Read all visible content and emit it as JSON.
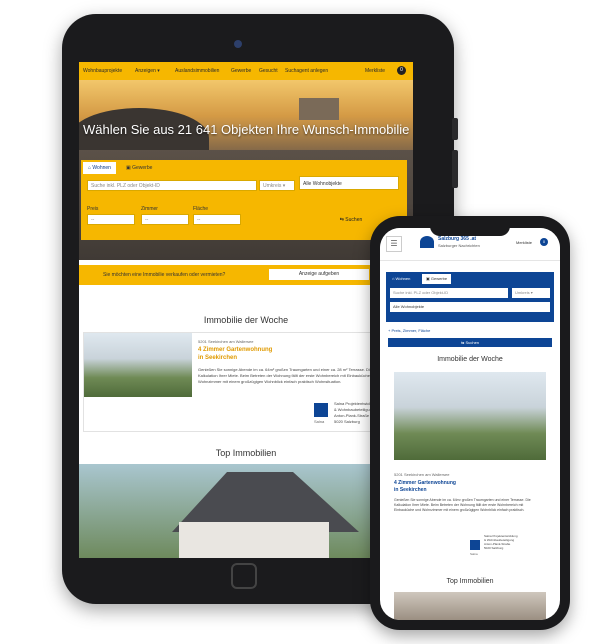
{
  "tablet": {
    "nav": {
      "items": [
        "Wohnbauprojekte",
        "Anzeigen ▾",
        "Auslandsimmobilien",
        "Gewerbe",
        "Gesucht",
        "Suchagent anlegen"
      ],
      "right": "Merkliste",
      "badge": "0"
    },
    "hero": {
      "title": "Wählen Sie aus 21 641 Objekten Ihre Wunsch-Immobilie"
    },
    "search": {
      "tab_wohnen": "⌂ Wohnen",
      "tab_gewerbe": "▣ Gewerbe",
      "input_placeholder": "Suche inkl. PLZ oder Objekt-ID",
      "radius": "Umkreis ▾",
      "type": "Alle Wohnobjekte",
      "label_price": "Preis",
      "label_rooms": "Zimmer",
      "label_area": "Fläche",
      "select_price": "--",
      "select_rooms": "--",
      "select_area": "--",
      "button": "⇆ Suchen"
    },
    "sell_bar": {
      "text": "Sie möchten eine Immobilie verkaufen oder vermieten?",
      "button": "Anzeige aufgeben"
    },
    "week": {
      "title": "Immobilie der Woche",
      "tag": "5201 Seekirchen am Wallersee",
      "prop_title_line1": "4 Zimmer Gartenwohnung",
      "prop_title_line2": "in Seekirchen",
      "desc": "Genießen Sie sonnige Abende im ca. 64m² großen Traumgarten und einer ca. 28 m² Terrasse. Die Kalkulation Ihrer Miete. Beim Betreten der Wohnung fällt der erste Wohnbereich mit Einbauküche und Wohnzimmer mit einem großzügigen Wohnblick einfach praktisch Wohnsituation.",
      "agent_lines": [
        "Salna Projektentwicklung",
        "& Wohnbaubeteiligung",
        "Anton-Plank-Straße",
        "5020 Salzburg"
      ],
      "logo_text": "Salna"
    },
    "top": {
      "title": "Top Immobilien"
    }
  },
  "phone": {
    "logo_line1": "Salzburg 365 .at",
    "logo_line2": "Salzburger Nachrichten",
    "merkliste": "Merkliste",
    "badge": "0",
    "search": {
      "tab_wohnen": "⌂ Wohnen",
      "tab_gewerbe": "▣ Gewerbe",
      "input_placeholder": "Suche inkl. PLZ oder Objekt-ID",
      "radius": "Umkreis ▾",
      "type": "Alle Wohnobjekte",
      "filters": "+ Preis, Zimmer, Fläche",
      "button": "⇆ Suchen"
    },
    "week": {
      "title": "Immobilie der Woche",
      "tag": "5201 Seekirchen am Wallersee",
      "prop_title_line1": "4 Zimmer Gartenwohnung",
      "prop_title_line2": "in Seekirchen",
      "desc": "Genießen Sie sonnige Abende im ca. 64m² großen Traumgarten und einer Terrasse. Die Kalkulation Ihrer Miete. Beim Betreten der Wohnung fällt der erste Wohnbereich mit Einbauküche und Wohnzimmer mit einem großzügigen Wohnblick einfach praktisch.",
      "agent_lines": [
        "Salna Projektentwicklung",
        "& Wohnbaubeteiligung",
        "Anton-Plank-Straße",
        "5020 Salzburg"
      ],
      "logo_text": "Salna"
    },
    "top": {
      "title": "Top Immobilien"
    }
  },
  "colors": {
    "brand_yellow": "#f6b700",
    "brand_blue": "#0d4595",
    "accent_orange": "#e09a00"
  }
}
